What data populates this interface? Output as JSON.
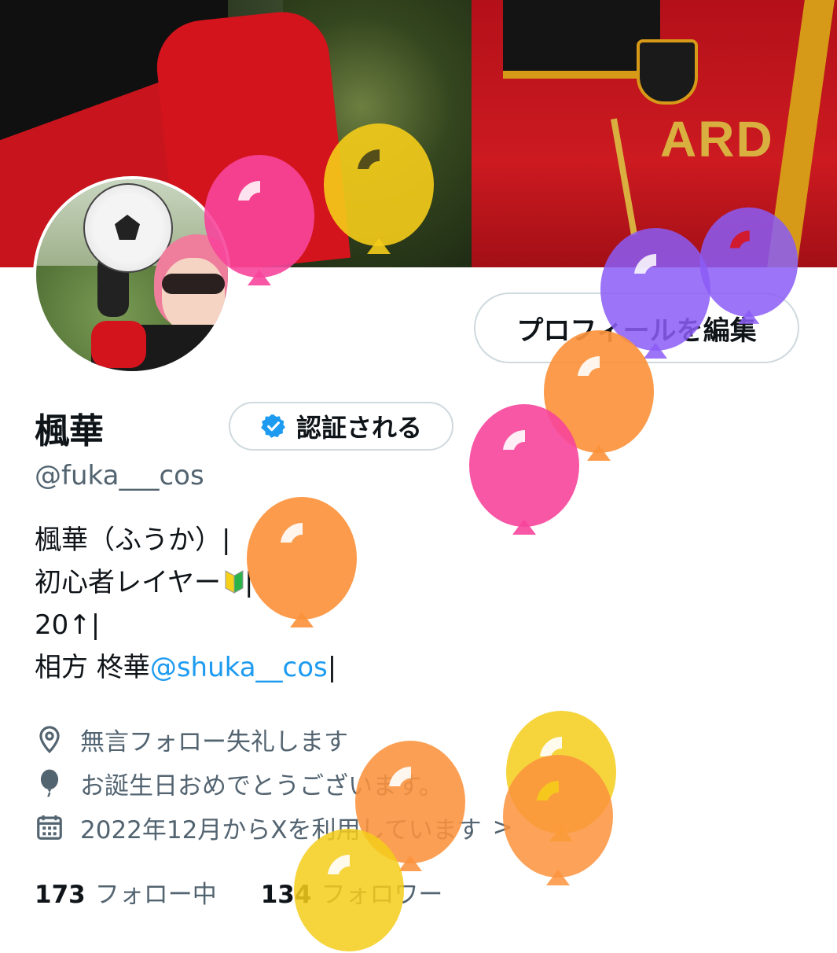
{
  "banner": {
    "jersey_text": "ARD"
  },
  "profile": {
    "edit_button_label": "プロフィールを編集",
    "display_name": "楓華",
    "verify_label": "認証される",
    "handle": "@fuka___cos"
  },
  "bio": {
    "line1": "楓華（ふうか）|",
    "line2_text": "初心者レイヤー",
    "line2_end": "|",
    "line3": "20↑|",
    "line4_text": "相方  柊華",
    "line4_mention": "@shuka__cos",
    "line4_end": "|"
  },
  "meta": {
    "location": "無言フォロー失礼します",
    "birthday": "お誕生日おめでとうございます。",
    "joined": "2022年12月からXを利用しています",
    "joined_arrow": ">"
  },
  "stats": {
    "following_count": "173",
    "following_label": "フォロー中",
    "followers_count": "134",
    "followers_label": "フォロワー"
  },
  "colors": {
    "accent": "#1d9bf0",
    "balloon_pink": "#f7459b",
    "balloon_yellow": "#f5cc1a",
    "balloon_purple": "#8b5cf6",
    "balloon_orange": "#fb923c"
  },
  "icons": [
    "location-icon",
    "balloon-icon",
    "calendar-icon",
    "verified-badge-icon",
    "beginner-mark-icon",
    "chevron-right-icon"
  ]
}
